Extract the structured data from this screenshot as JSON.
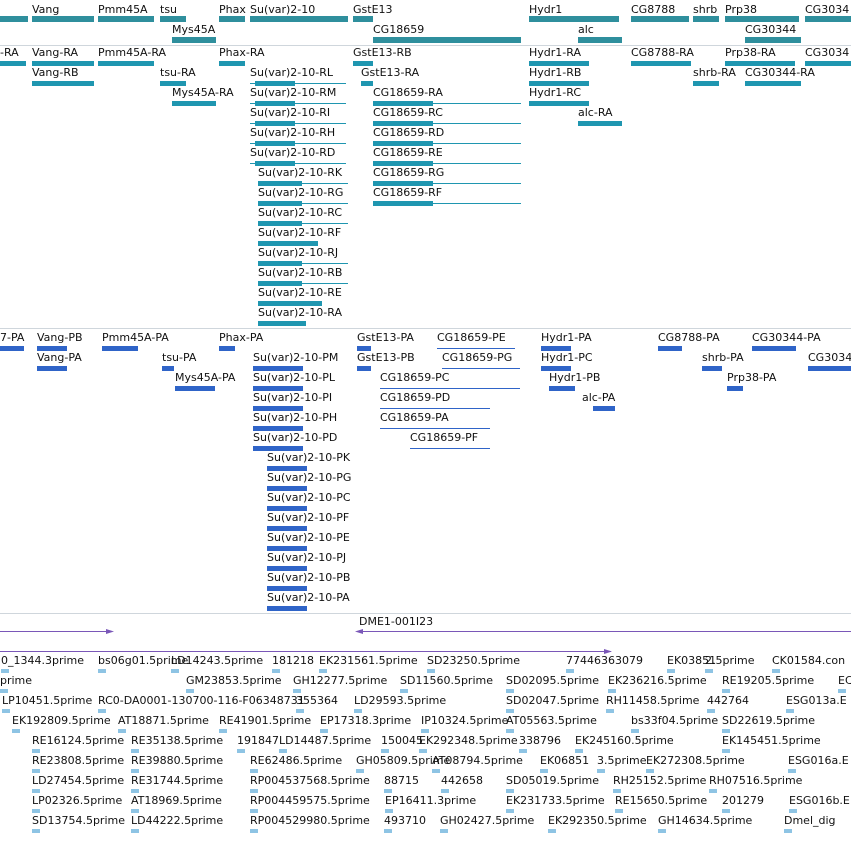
{
  "colors": {
    "gene": "#2f8f9d",
    "transcript": "#1f96b0",
    "protein": "#2f64c8",
    "est": "#8ec4e4",
    "clone": "#7a57b8"
  },
  "genes": [
    {
      "id": "g1",
      "label": "Vang"
    },
    {
      "id": "g2",
      "label": "Pmm45A"
    },
    {
      "id": "g3",
      "label": "tsu"
    },
    {
      "id": "g4",
      "label": "Phax"
    },
    {
      "id": "g5",
      "label": "Su(var)2-10"
    },
    {
      "id": "g6",
      "label": "GstE13"
    },
    {
      "id": "g7",
      "label": "Mys45A"
    },
    {
      "id": "g8",
      "label": "CG18659"
    },
    {
      "id": "g9",
      "label": "Hydr1"
    },
    {
      "id": "g10",
      "label": "alc"
    },
    {
      "id": "g11",
      "label": "CG8788"
    },
    {
      "id": "g12",
      "label": "shrb"
    },
    {
      "id": "g13",
      "label": "Prp38"
    },
    {
      "id": "g14",
      "label": "CG30344"
    },
    {
      "id": "g15",
      "label": "CG3034"
    }
  ],
  "transcripts": [
    {
      "label": "-RA"
    },
    {
      "label": "Vang-RA"
    },
    {
      "label": "Pmm45A-RA"
    },
    {
      "label": "Vang-RB"
    },
    {
      "label": "tsu-RA"
    },
    {
      "label": "Mys45A-RA"
    },
    {
      "label": "Phax-RA"
    },
    {
      "label": "GstE13-RB"
    },
    {
      "label": "GstE13-RA"
    },
    {
      "label": "Su(var)2-10-RL"
    },
    {
      "label": "Su(var)2-10-RM"
    },
    {
      "label": "Su(var)2-10-RI"
    },
    {
      "label": "Su(var)2-10-RH"
    },
    {
      "label": "Su(var)2-10-RD"
    },
    {
      "label": "Su(var)2-10-RK"
    },
    {
      "label": "Su(var)2-10-RG"
    },
    {
      "label": "Su(var)2-10-RC"
    },
    {
      "label": "Su(var)2-10-RF"
    },
    {
      "label": "Su(var)2-10-RJ"
    },
    {
      "label": "Su(var)2-10-RB"
    },
    {
      "label": "Su(var)2-10-RE"
    },
    {
      "label": "Su(var)2-10-RA"
    },
    {
      "label": "CG18659-RA"
    },
    {
      "label": "CG18659-RC"
    },
    {
      "label": "CG18659-RD"
    },
    {
      "label": "CG18659-RE"
    },
    {
      "label": "CG18659-RG"
    },
    {
      "label": "CG18659-RF"
    },
    {
      "label": "Hydr1-RA"
    },
    {
      "label": "Hydr1-RB"
    },
    {
      "label": "Hydr1-RC"
    },
    {
      "label": "alc-RA"
    },
    {
      "label": "CG8788-RA"
    },
    {
      "label": "Prp38-RA"
    },
    {
      "label": "shrb-RA"
    },
    {
      "label": "CG30344-RA"
    },
    {
      "label": "CG3034"
    }
  ],
  "proteins": [
    {
      "label": "7-PA"
    },
    {
      "label": "Vang-PB"
    },
    {
      "label": "Pmm45A-PA"
    },
    {
      "label": "Phax-PA"
    },
    {
      "label": "Vang-PA"
    },
    {
      "label": "tsu-PA"
    },
    {
      "label": "Mys45A-PA"
    },
    {
      "label": "GstE13-PA"
    },
    {
      "label": "GstE13-PB"
    },
    {
      "label": "CG18659-PE"
    },
    {
      "label": "CG18659-PG"
    },
    {
      "label": "CG18659-PC"
    },
    {
      "label": "CG18659-PD"
    },
    {
      "label": "CG18659-PA"
    },
    {
      "label": "CG18659-PF"
    },
    {
      "label": "Su(var)2-10-PM"
    },
    {
      "label": "Su(var)2-10-PL"
    },
    {
      "label": "Su(var)2-10-PI"
    },
    {
      "label": "Su(var)2-10-PH"
    },
    {
      "label": "Su(var)2-10-PD"
    },
    {
      "label": "Su(var)2-10-PK"
    },
    {
      "label": "Su(var)2-10-PG"
    },
    {
      "label": "Su(var)2-10-PC"
    },
    {
      "label": "Su(var)2-10-PF"
    },
    {
      "label": "Su(var)2-10-PE"
    },
    {
      "label": "Su(var)2-10-PJ"
    },
    {
      "label": "Su(var)2-10-PB"
    },
    {
      "label": "Su(var)2-10-PA"
    },
    {
      "label": "Hydr1-PA"
    },
    {
      "label": "Hydr1-PC"
    },
    {
      "label": "Hydr1-PB"
    },
    {
      "label": "alc-PA"
    },
    {
      "label": "CG8788-PA"
    },
    {
      "label": "CG30344-PA"
    },
    {
      "label": "shrb-PA"
    },
    {
      "label": "Prp38-PA"
    },
    {
      "label": "CG3034"
    }
  ],
  "clone": {
    "label": "DME1-001I23"
  },
  "ests": [
    "0_1344.3prime",
    "bs06g01.5prime",
    "LD14243.5prime",
    "181218",
    "EK231561.5prime",
    "SD23250.5prime",
    "77446363079",
    "EK03851",
    "2.5prime",
    "CK01584.con",
    "prime",
    "GM23853.5prime",
    "GH12277.5prime",
    "SD11560.5prime",
    "SD02095.5prime",
    "EK236216.5prime",
    "RE19205.5prime",
    "EC",
    "LP10451.5prime",
    "RC0-DA0001-130700-116-F06348731",
    "355364",
    "LD29593.5prime",
    "SD02047.5prime",
    "RH11458.5prime",
    "442764",
    "ESG013a.E",
    "EK192809.5prime",
    "AT18871.5prime",
    "RE41901.5prime",
    "EP17318.3prime",
    "IP10324.5prime",
    "AT05563.5prime",
    "bs33f04.5prime",
    "SD22619.5prime",
    "RE16124.5prime",
    "RE35138.5prime",
    "191847",
    "LD14487.5prime",
    "150045",
    "EK292348.5prime",
    "338796",
    "EK245160.5prime",
    "EK145451.5prime",
    "RE23808.5prime",
    "RE39880.5prime",
    "RE62486.5prime",
    "GH05809.5prime",
    "AT08794.5prime",
    "EK06851",
    "3.5prime",
    "EK272308.5prime",
    "ESG016a.E",
    "LD27454.5prime",
    "RE31744.5prime",
    "RP004537568.5prime",
    "88715",
    "442658",
    "SD05019.5prime",
    "RH25152.5prime",
    "RH07516.5prime",
    "LP02326.5prime",
    "AT18969.5prime",
    "RP004459575.5prime",
    "EP16411.3prime",
    "EK231733.5prime",
    "RE15650.5prime",
    "201279",
    "ESG016b.E",
    "SD13754.5prime",
    "LD44222.5prime",
    "RP004529980.5prime",
    "493710",
    "GH02427.5prime",
    "EK292350.5prime",
    "GH14634.5prime",
    "Dmel_dig"
  ]
}
